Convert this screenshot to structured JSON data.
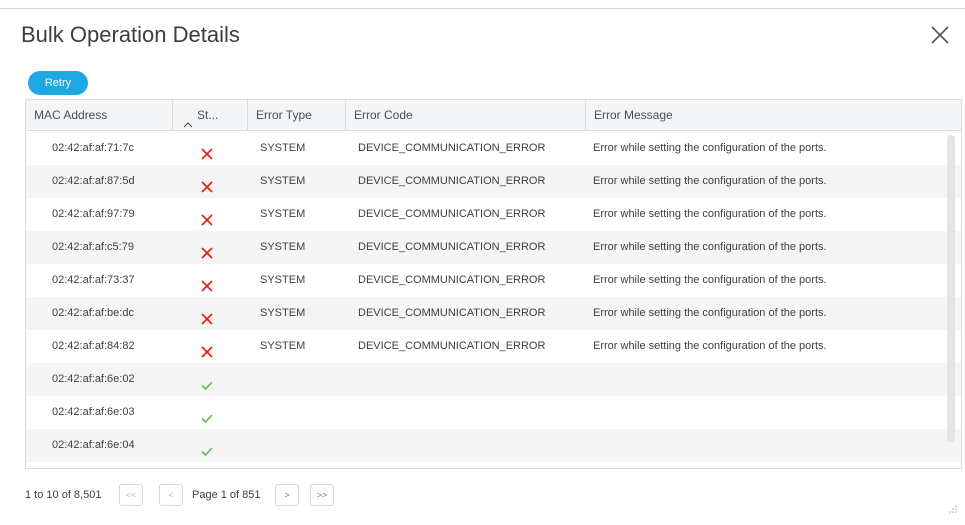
{
  "dialog": {
    "title": "Bulk Operation Details",
    "close_icon": "close-icon"
  },
  "toolbar": {
    "retry_label": "Retry"
  },
  "colors": {
    "accent": "#1ea7e0",
    "error": "#e2231a",
    "success": "#5cb85c"
  },
  "table": {
    "columns": [
      "MAC Address",
      "St...",
      "Error Type",
      "Error Code",
      "Error Message"
    ],
    "sort_icon": "sort-ascending-icon",
    "rows": [
      {
        "mac": "02:42:af:af:71:7c",
        "status": "error",
        "type": "SYSTEM",
        "code": "DEVICE_COMMUNICATION_ERROR",
        "message": "Error while setting the configuration of the ports."
      },
      {
        "mac": "02:42:af:af:87:5d",
        "status": "error",
        "type": "SYSTEM",
        "code": "DEVICE_COMMUNICATION_ERROR",
        "message": "Error while setting the configuration of the ports."
      },
      {
        "mac": "02:42:af:af:97:79",
        "status": "error",
        "type": "SYSTEM",
        "code": "DEVICE_COMMUNICATION_ERROR",
        "message": "Error while setting the configuration of the ports."
      },
      {
        "mac": "02:42:af:af:c5:79",
        "status": "error",
        "type": "SYSTEM",
        "code": "DEVICE_COMMUNICATION_ERROR",
        "message": "Error while setting the configuration of the ports."
      },
      {
        "mac": "02:42:af:af:73:37",
        "status": "error",
        "type": "SYSTEM",
        "code": "DEVICE_COMMUNICATION_ERROR",
        "message": "Error while setting the configuration of the ports."
      },
      {
        "mac": "02:42:af:af:be:dc",
        "status": "error",
        "type": "SYSTEM",
        "code": "DEVICE_COMMUNICATION_ERROR",
        "message": "Error while setting the configuration of the ports."
      },
      {
        "mac": "02:42:af:af:84:82",
        "status": "error",
        "type": "SYSTEM",
        "code": "DEVICE_COMMUNICATION_ERROR",
        "message": "Error while setting the configuration of the ports."
      },
      {
        "mac": "02:42:af:af:6e:02",
        "status": "success",
        "type": "",
        "code": "",
        "message": ""
      },
      {
        "mac": "02:42:af:af:6e:03",
        "status": "success",
        "type": "",
        "code": "",
        "message": ""
      },
      {
        "mac": "02:42:af:af:6e:04",
        "status": "success",
        "type": "",
        "code": "",
        "message": ""
      }
    ]
  },
  "pagination": {
    "range_text": "1 to 10 of 8,501",
    "first_label": "<<",
    "prev_label": "<",
    "page_text": "Page 1 of 851",
    "next_label": ">",
    "last_label": ">>"
  }
}
